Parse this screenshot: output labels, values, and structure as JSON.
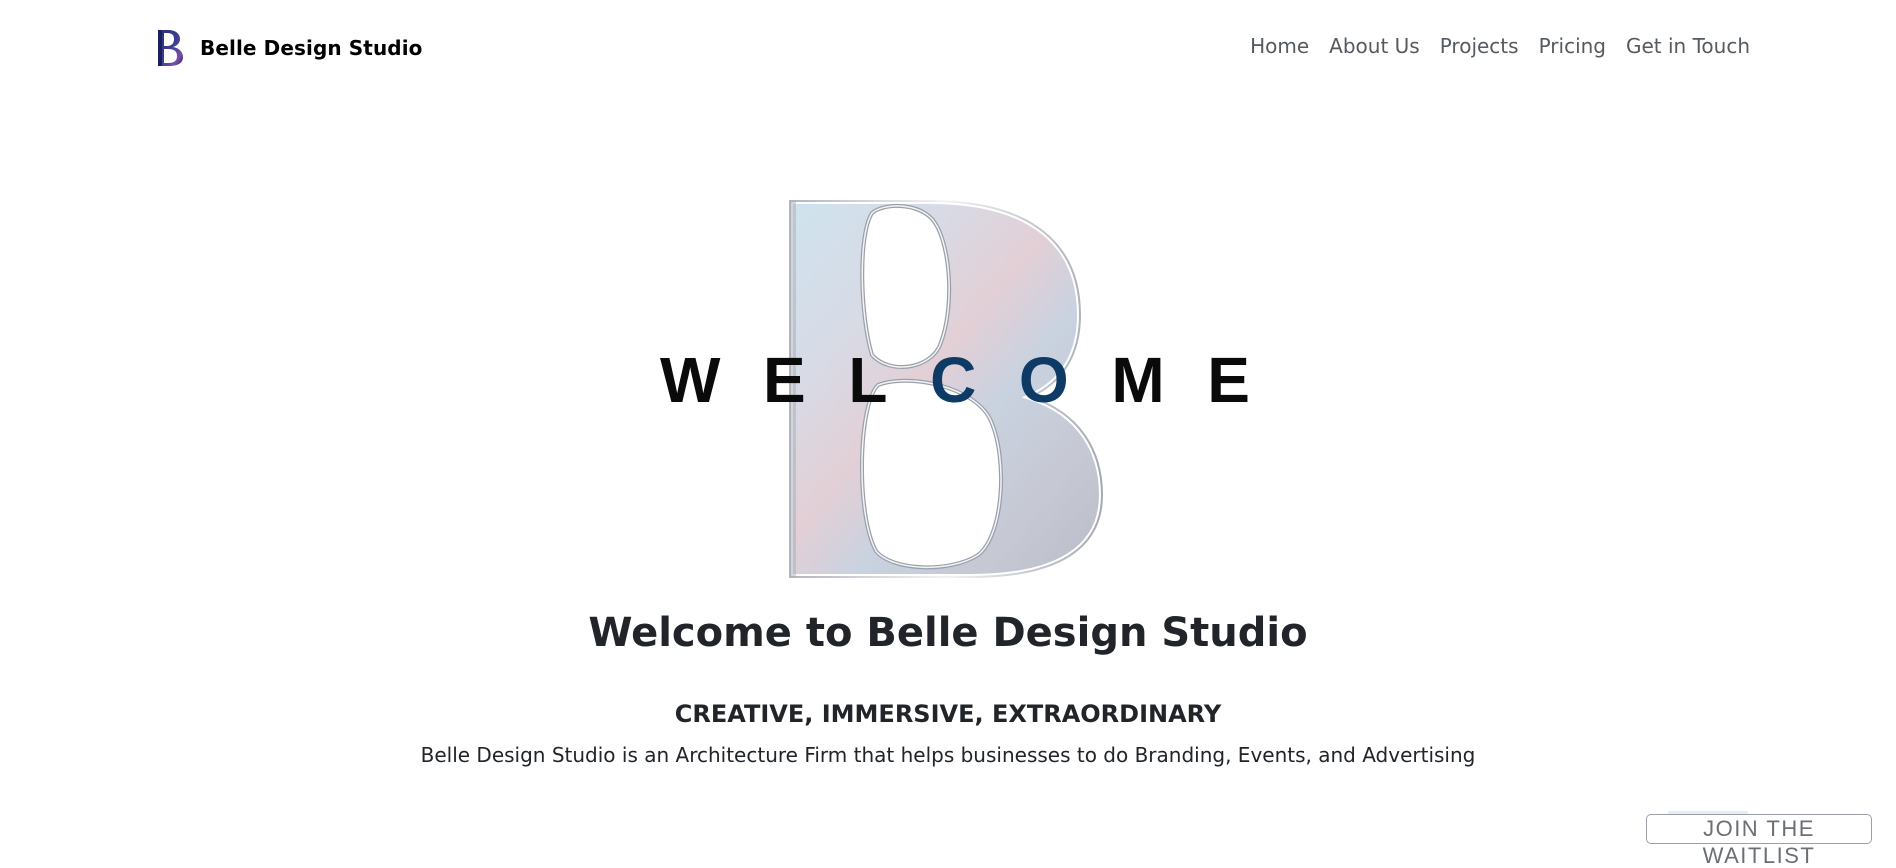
{
  "brand": {
    "name": "Belle Design Studio",
    "logo_icon": "b-monogram-logo"
  },
  "nav": {
    "items": [
      {
        "label": "Home"
      },
      {
        "label": "About Us"
      },
      {
        "label": "Projects"
      },
      {
        "label": "Pricing"
      },
      {
        "label": "Get in Touch"
      }
    ]
  },
  "hero": {
    "graphic_icon": "b-letter-graphic",
    "welcome_letters": [
      "W",
      "E",
      "L",
      "C",
      "O",
      "M",
      "E"
    ],
    "title": "Welcome to Belle Design Studio",
    "tagline": "CREATIVE, IMMERSIVE, EXTRAORDINARY",
    "description": "Belle Design Studio is an Architecture Firm that helps businesses to do Branding, Events, and Advertising"
  },
  "cta": {
    "waitlist_label": "JOIN THE WAITLIST"
  },
  "colors": {
    "text": "#212529",
    "nav_link": "#555a5f",
    "welcome_dark": "#0a0a0a",
    "welcome_blue": "#0e3a66",
    "brand_logo_navy": "#1a1f5e",
    "button_border": "#9aa0a6"
  }
}
